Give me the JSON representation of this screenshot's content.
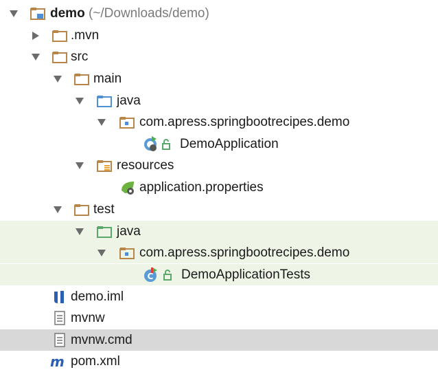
{
  "tree": {
    "root": {
      "label": "demo",
      "path": "(~/Downloads/demo)",
      "expanded": true,
      "icon": "module-folder-icon"
    },
    "mvn": {
      "label": ".mvn",
      "expanded": false,
      "icon": "folder-icon"
    },
    "src": {
      "label": "src",
      "expanded": true,
      "icon": "folder-icon"
    },
    "main": {
      "label": "main",
      "expanded": true,
      "icon": "folder-icon"
    },
    "main_java": {
      "label": "java",
      "expanded": true,
      "icon": "source-folder-icon"
    },
    "main_package": {
      "label": "com.apress.springbootrecipes.demo",
      "expanded": true,
      "icon": "package-icon"
    },
    "demo_application": {
      "label": "DemoApplication",
      "icon": "spring-boot-class-icon"
    },
    "resources": {
      "label": "resources",
      "expanded": true,
      "icon": "resources-folder-icon"
    },
    "application_properties": {
      "label": "application.properties",
      "icon": "spring-properties-icon"
    },
    "test": {
      "label": "test",
      "expanded": true,
      "icon": "folder-icon"
    },
    "test_java": {
      "label": "java",
      "expanded": true,
      "icon": "test-source-folder-icon"
    },
    "test_package": {
      "label": "com.apress.springbootrecipes.demo",
      "expanded": true,
      "icon": "package-icon"
    },
    "demo_application_tests": {
      "label": "DemoApplicationTests",
      "icon": "test-class-icon"
    },
    "demo_iml": {
      "label": "demo.iml",
      "icon": "intellij-module-file-icon"
    },
    "mvnw": {
      "label": "mvnw",
      "icon": "text-file-icon"
    },
    "mvnw_cmd": {
      "label": "mvnw.cmd",
      "icon": "text-file-icon",
      "selected": true
    },
    "pom_xml": {
      "label": "pom.xml",
      "icon": "maven-icon"
    }
  },
  "colors": {
    "folder": "#b9864a",
    "source_folder": "#4f8fd6",
    "test_source_folder": "#59a869",
    "test_highlight": "#eef5e6",
    "selection": "#d8d8d8",
    "arrow": "#6b6b6b"
  }
}
